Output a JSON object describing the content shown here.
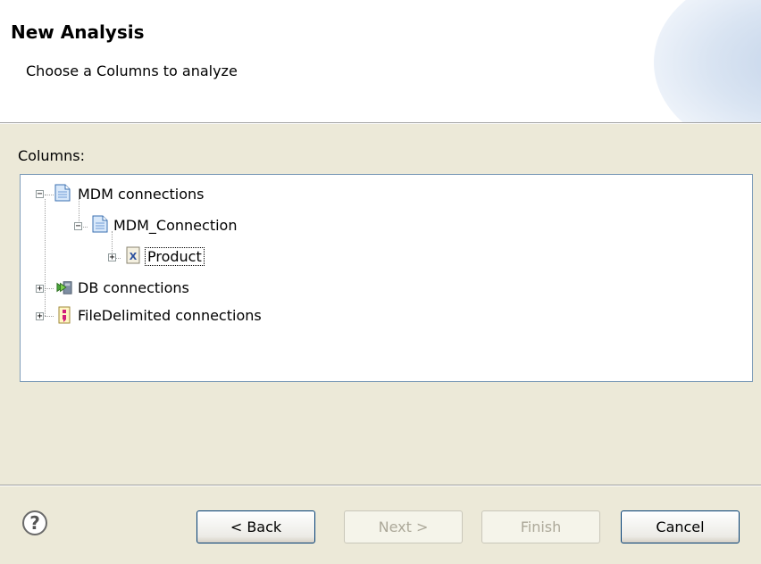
{
  "header": {
    "title": "New Analysis",
    "description": "Choose a Columns to analyze"
  },
  "columns_label": "Columns:",
  "tree": {
    "nodes": [
      {
        "label": "MDM connections",
        "icon": "document-icon",
        "expander": "−",
        "expanded": true
      },
      {
        "label": "MDM_Connection",
        "icon": "document-icon",
        "expander": "−",
        "expanded": true
      },
      {
        "label": "Product",
        "icon": "xml-file-icon",
        "expander": "+",
        "expanded": false,
        "selected": true
      },
      {
        "label": "DB connections",
        "icon": "database-icon",
        "expander": "+",
        "expanded": false
      },
      {
        "label": "FileDelimited connections",
        "icon": "file-delimited-icon",
        "expander": "+",
        "expanded": false
      }
    ]
  },
  "footer": {
    "help_icon": "?",
    "back_label": "< Back",
    "next_label": "Next >",
    "finish_label": "Finish",
    "cancel_label": "Cancel"
  },
  "colors": {
    "header_background": "#ffffff",
    "dialog_background": "#ece9d8",
    "tree_border": "#7f9db9",
    "button_border": "#003c74",
    "disabled_text": "#aca899"
  }
}
